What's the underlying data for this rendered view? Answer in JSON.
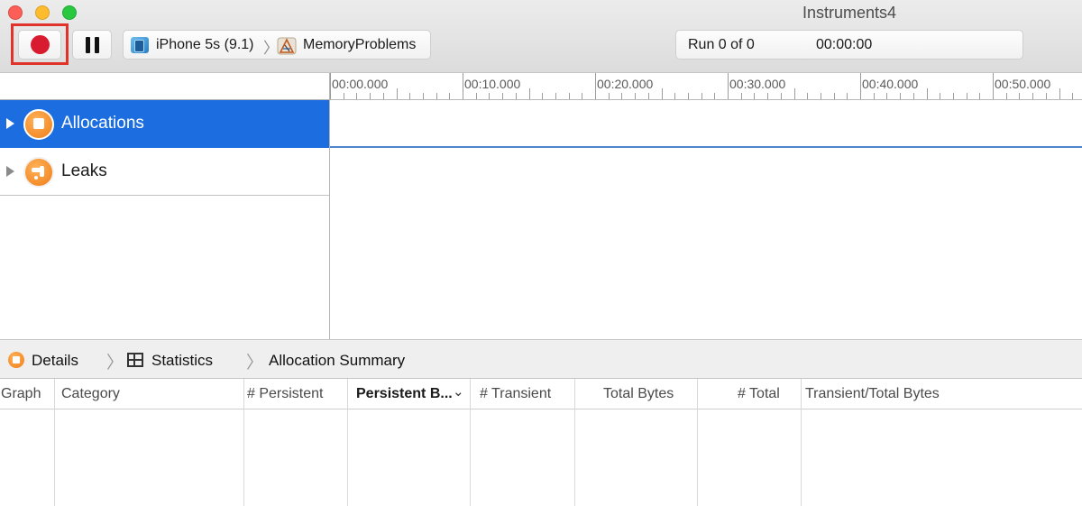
{
  "window": {
    "title": "Instruments4"
  },
  "toolbar": {
    "record_icon": "record-icon",
    "pause_icon": "pause-icon",
    "device": "iPhone 5s (9.1)",
    "separator": "〉",
    "target_app": "MemoryProblems",
    "run_label": "Run 0 of 0",
    "run_time": "00:00:00"
  },
  "ruler": {
    "labels": [
      "00:00.000",
      "00:10.000",
      "00:20.000",
      "00:30.000",
      "00:40.000",
      "00:50.000"
    ]
  },
  "tracks": [
    {
      "name": "Allocations",
      "icon": "allocations-icon",
      "selected": true
    },
    {
      "name": "Leaks",
      "icon": "leaks-icon",
      "selected": false
    }
  ],
  "detail_nav": {
    "details": "Details",
    "statistics": "Statistics",
    "summary": "Allocation Summary",
    "separator": "〉"
  },
  "table": {
    "columns": [
      {
        "label": "Graph"
      },
      {
        "label": "Category"
      },
      {
        "label": "# Persistent"
      },
      {
        "label": "Persistent B...",
        "sorted": true
      },
      {
        "label": "# Transient"
      },
      {
        "label": "Total Bytes"
      },
      {
        "label": "# Total"
      },
      {
        "label": "Transient/Total Bytes"
      }
    ],
    "rows": []
  },
  "colors": {
    "selection": "#1c6ee0",
    "record": "#d81b2e",
    "highlight": "#e0342a",
    "instrument": "#ef7d17"
  }
}
